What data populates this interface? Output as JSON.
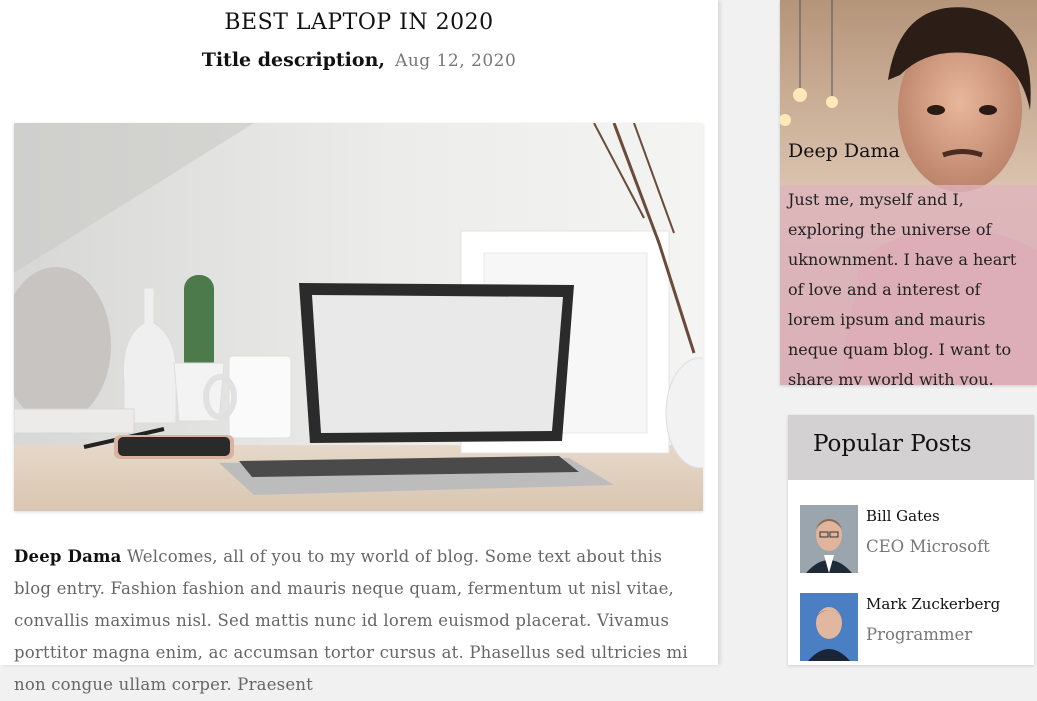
{
  "post": {
    "title": "BEST LAPTOP IN 2020",
    "description": "Title description,",
    "date": "Aug 12, 2020",
    "author": "Deep Dama",
    "body": " Welcomes, all of you to my world of blog. Some text about this blog entry. Fashion fashion and mauris neque quam, fermentum ut nisl vitae, convallis maximus nisl. Sed mattis nunc id lorem euismod placerat. Vivamus porttitor magna enim, ac accumsan tortor cursus at. Phasellus sed ultricies mi non congue ullam corper. Praesent"
  },
  "profile": {
    "name": "Deep Dama",
    "bio": "Just me, myself and I, exploring the universe of uknownment. I have a heart of love and a interest of lorem ipsum and mauris neque quam blog. I want to share my world with you."
  },
  "popular": {
    "heading": "Popular Posts",
    "items": [
      {
        "name": "Bill Gates",
        "role": "CEO Microsoft"
      },
      {
        "name": "Mark Zuckerberg",
        "role": "Programmer"
      }
    ]
  }
}
